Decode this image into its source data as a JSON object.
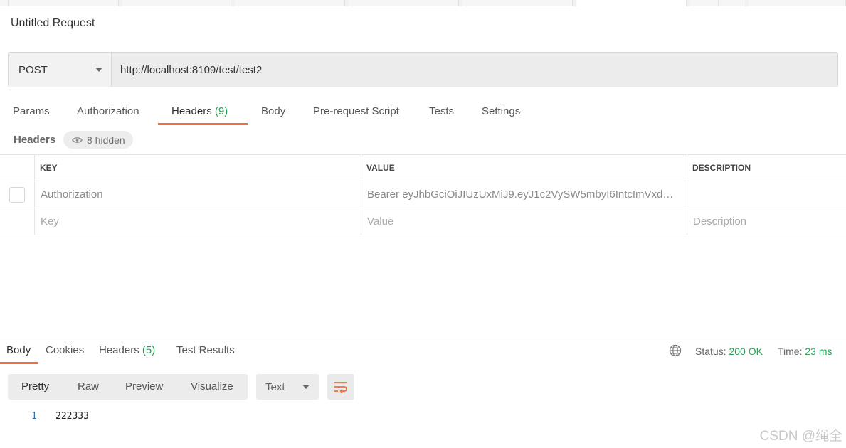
{
  "request": {
    "title": "Untitled Request",
    "method": "POST",
    "url": "http://localhost:8109/test/test2"
  },
  "request_tabs": [
    {
      "label": "Params",
      "count": ""
    },
    {
      "label": "Authorization",
      "count": ""
    },
    {
      "label": "Headers",
      "count": "(9)"
    },
    {
      "label": "Body",
      "count": ""
    },
    {
      "label": "Pre-request Script",
      "count": ""
    },
    {
      "label": "Tests",
      "count": ""
    },
    {
      "label": "Settings",
      "count": ""
    }
  ],
  "headers_section": {
    "label": "Headers",
    "hidden_label": "8 hidden"
  },
  "headers_table": {
    "columns": [
      "KEY",
      "VALUE",
      "DESCRIPTION"
    ],
    "rows": [
      {
        "key": "Authorization",
        "value": "Bearer eyJhbGciOiJIUzUxMiJ9.eyJ1c2VySW5mbyI6IntcImVxdWl...",
        "description": ""
      }
    ],
    "new_row": {
      "key_placeholder": "Key",
      "value_placeholder": "Value",
      "description_placeholder": "Description"
    }
  },
  "response_tabs": [
    {
      "label": "Body",
      "count": ""
    },
    {
      "label": "Cookies",
      "count": ""
    },
    {
      "label": "Headers",
      "count": "(5)"
    },
    {
      "label": "Test Results",
      "count": ""
    }
  ],
  "response_status": {
    "status_label": "Status:",
    "status_value": "200 OK",
    "time_label": "Time:",
    "time_value": "23 ms"
  },
  "view_modes": [
    "Pretty",
    "Raw",
    "Preview",
    "Visualize"
  ],
  "format_select": "Text",
  "response_body": {
    "line_number": "1",
    "content": "222333"
  },
  "watermark": "CSDN @绳全",
  "colors": {
    "accent": "#f06d3f",
    "success": "#2a9d56"
  }
}
